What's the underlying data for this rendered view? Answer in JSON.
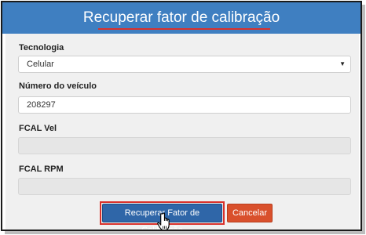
{
  "dialog": {
    "title": "Recuperar fator de calibração"
  },
  "form": {
    "tecnologia": {
      "label": "Tecnologia",
      "value": "Celular"
    },
    "numero_veiculo": {
      "label": "Número do veículo",
      "value": "208297"
    },
    "fcal_vel": {
      "label": "FCAL Vel",
      "value": ""
    },
    "fcal_rpm": {
      "label": "FCAL RPM",
      "value": ""
    }
  },
  "buttons": {
    "recuperar": "Recuperar Fator de Calibração",
    "cancelar": "Cancelar"
  },
  "icons": {
    "select_caret": "caret-down-icon",
    "cursor": "hand-pointer-icon"
  },
  "colors": {
    "header": "#3f7fc1",
    "primary": "#2f66a8",
    "danger": "#d9502c",
    "highlight": "#d9312b"
  }
}
